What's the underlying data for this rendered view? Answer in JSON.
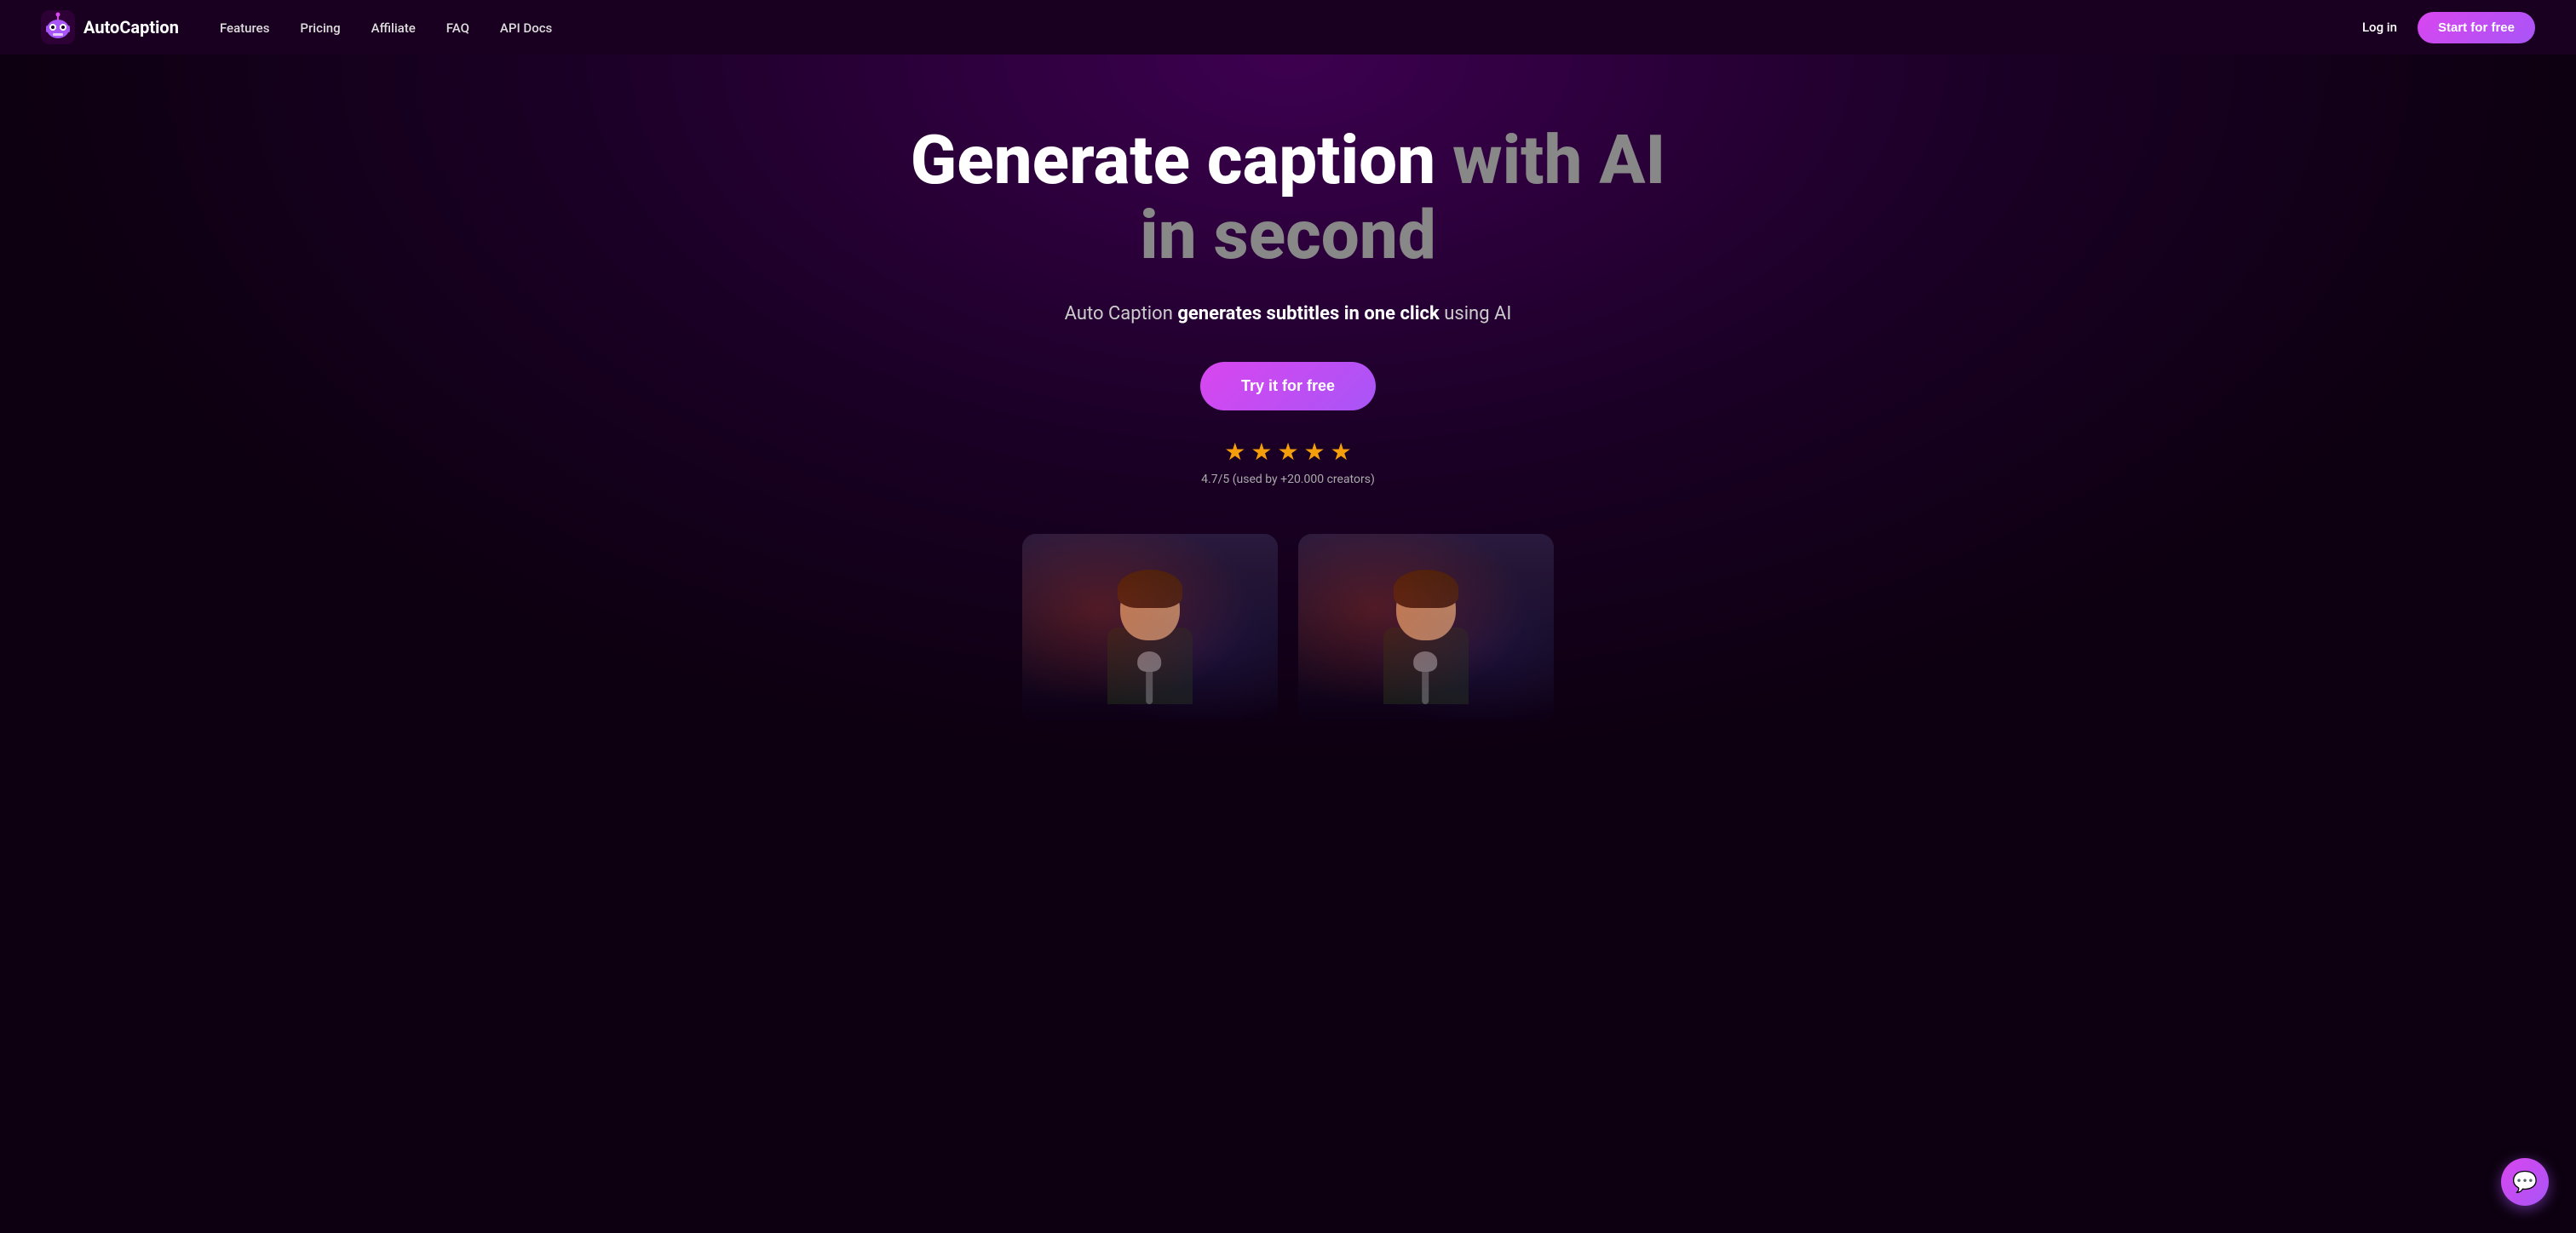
{
  "nav": {
    "logo_text": "AutoCaption",
    "links": [
      {
        "label": "Features",
        "href": "#features"
      },
      {
        "label": "Pricing",
        "href": "#pricing"
      },
      {
        "label": "Affiliate",
        "href": "#affiliate"
      },
      {
        "label": "FAQ",
        "href": "#faq"
      },
      {
        "label": "API Docs",
        "href": "#api"
      }
    ],
    "login_label": "Log in",
    "start_label": "Start for free"
  },
  "hero": {
    "title_line1_white": "Generate caption",
    "title_line1_gray": "with AI",
    "title_line2_gray": "in second",
    "subtitle_plain1": "Auto Caption ",
    "subtitle_bold": "generates subtitles in one click",
    "subtitle_plain2": " using AI",
    "cta_label": "Try it for free",
    "rating_stars": 5,
    "rating_value": "4.7/5 (used by +20.000 creators)"
  },
  "chat_button": {
    "icon": "💬"
  }
}
